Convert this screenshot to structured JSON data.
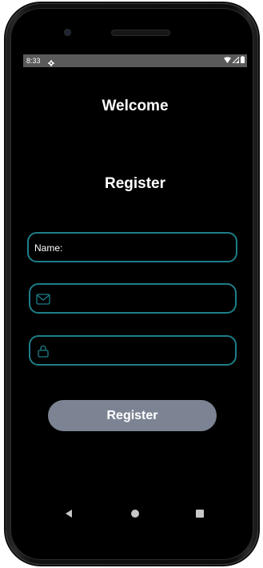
{
  "status_bar": {
    "time": "8:33",
    "icons": [
      "settings-gear-icon",
      "wifi-icon",
      "signal-icon",
      "battery-icon"
    ]
  },
  "screen": {
    "welcome_text": "Welcome",
    "register_title": "Register",
    "name_field": {
      "label": "Name:",
      "value": ""
    },
    "email_field": {
      "icon": "mail-icon",
      "value": ""
    },
    "password_field": {
      "icon": "lock-icon",
      "value": ""
    },
    "register_button_label": "Register"
  },
  "nav_bar": {
    "icons": [
      "back-icon",
      "home-icon",
      "recents-icon"
    ]
  },
  "colors": {
    "background": "#000000",
    "field_border": "#1d7e88",
    "button_background": "#7c8494",
    "text": "#ffffff",
    "status_bar": "#5a5a5a"
  }
}
